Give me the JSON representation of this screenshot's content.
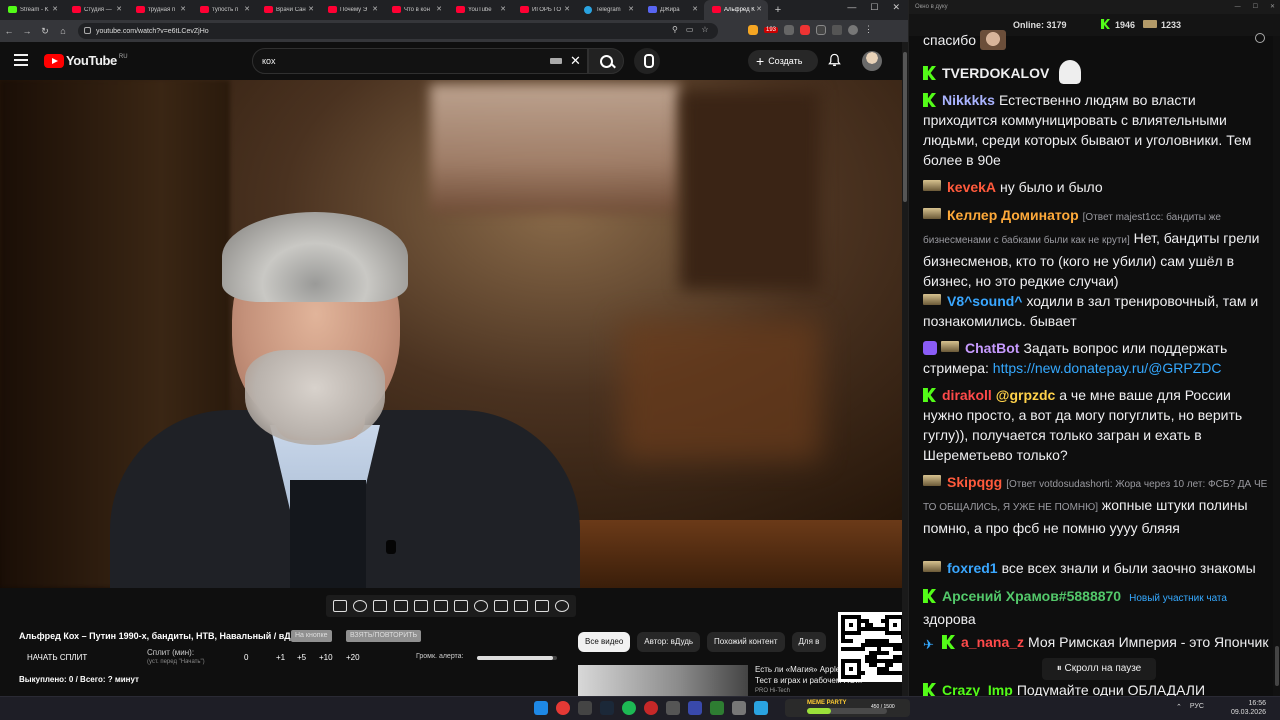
{
  "browser": {
    "tabs": [
      {
        "label": "Stream - K",
        "icon": "kick-icon"
      },
      {
        "label": "Студия —",
        "icon": "youtube-icon"
      },
      {
        "label": "трудная п",
        "icon": "youtube-icon"
      },
      {
        "label": "тупость п",
        "icon": "youtube-icon"
      },
      {
        "label": "Врачи Сан",
        "icon": "youtube-icon"
      },
      {
        "label": "Почему Э",
        "icon": "youtube-icon"
      },
      {
        "label": "Что в кон",
        "icon": "youtube-icon"
      },
      {
        "label": "YouTube",
        "icon": "youtube-icon"
      },
      {
        "label": "ИГОРЬ ГО",
        "icon": "youtube-icon"
      },
      {
        "label": "Telegram",
        "icon": "telegram-icon"
      },
      {
        "label": "ДЖира",
        "icon": "discord-icon"
      },
      {
        "label": "Альфред К",
        "icon": "youtube-icon",
        "active": true
      }
    ],
    "url": "youtube.com/watch?v=e6tLCevZjHo",
    "ext_badge": "193"
  },
  "youtube": {
    "logo_text": "YouTube",
    "region": "RU",
    "search_query": "кох",
    "create_label": "Создать"
  },
  "player": {
    "video_title": "Альфред Кох – Путин 1990-х, бандиты, НТВ, Навальный / вДудь",
    "badge_left": "На кнопке",
    "badge_right": "ВЗЯТЬ/ПОВТОРИТЬ",
    "split_button": "НАЧАТЬ СПЛИТ",
    "split_label": "Сплит (мин):",
    "split_sub": "(уст. перед \"Начать\")",
    "split_values": [
      "0",
      "+1",
      "+5",
      "+10",
      "+20"
    ],
    "alert_label": "Громк. алерта:",
    "alert_level": 0.95,
    "bought": "Выкуплено: 0 / Всего: ? минут"
  },
  "recommend": {
    "chips": [
      "Все видео",
      "Автор: вДудь",
      "Похожий контент",
      "Для в"
    ],
    "video_title": "Есть ли «Магия» Apple?",
    "video_title2": "Тест в играх и рабочем ПО...",
    "video_meta": "PRO Hi-Tech"
  },
  "chat": {
    "window_title": "Окно в дуку",
    "online_label": "Online:",
    "online_count": "3179",
    "kick_count": "1946",
    "twitch_count": "1233",
    "messages": [
      {
        "user": "",
        "text": "спасибо",
        "user_color": "#efeff1"
      },
      {
        "user": "TVERDOKALOV",
        "text": "",
        "user_color": "#efeff1"
      },
      {
        "user": "Nikkkks",
        "text": "Естественно людям во власти приходится коммуницировать с влиятельными людьми, среди которых бывают и уголовники. Тем более в 90е",
        "user_color": "#aab4ff"
      },
      {
        "user": "kevekA",
        "text": "ну было и было",
        "user_color": "#ff5a3c"
      },
      {
        "user": "Келлер Доминатор",
        "reply": "[Ответ majest1cc: бандиты же бизнесменами с бабками были как не крути]",
        "text": "Нет, бандиты грели бизнесменов, кто то (кого не убили) сам ушёл в бизнес, но это редкие случаи)",
        "user_color": "#ffaa3a"
      },
      {
        "user": "V8^sound^",
        "text": "ходили в зал тренировочный, там и познакомились. бывает",
        "user_color": "#3aa7ff"
      },
      {
        "user": "ChatBot",
        "text": "Задать вопрос или поддержать стримера:",
        "link": "https://new.donatepay.ru/@GRPZDC",
        "user_color": "#c79bff"
      },
      {
        "user": "dirakoll",
        "mention": "@grpzdc",
        "text": "а че мне ваше для России нужно просто, а вот да могу погуглить, но верить гуглу)), получается только загран и ехать в Шереметьево только?",
        "user_color": "#ff4a4a"
      },
      {
        "user": "Skipqgg",
        "reply": "[Ответ votdosudashorti: Жора через 10 лет: ФСБ? ДА ЧЕ ТО ОБЩАЛИСЬ, Я УЖЕ НЕ ПОМНЮ]",
        "text": "жопные штуки полины помню, а про фсб не помню уууу бляяя",
        "user_color": "#ff5a3c"
      },
      {
        "user": "foxred1",
        "text": "все всех знали и были заочно знакомы",
        "user_color": "#3aa7ff"
      },
      {
        "user": "Арсений Храмов#5888870",
        "newuser": "Новый участник чата",
        "text": "здорова",
        "user_color": "#53c86a"
      },
      {
        "user": "a_nana_z",
        "text": "Моя Римская Империя - это Япончик",
        "user_color": "#ff4a4a"
      },
      {
        "user": "Crazy_Imp",
        "text": "Подумайте одни ОБЛАДАЛИ",
        "user_color": "#53fc18"
      }
    ],
    "pause_label": "⏸ Скролл на паузе"
  },
  "taskbar": {
    "widget_label": "MEME PARTY",
    "widget_count": "450 / 1500",
    "widget_progress": 0.3,
    "lang": "РУС",
    "time": "16:56",
    "date": "09.03.2026"
  },
  "colors": {
    "kick": "#53fc18",
    "youtube_red": "#ff0000",
    "link": "#35a9ff"
  }
}
